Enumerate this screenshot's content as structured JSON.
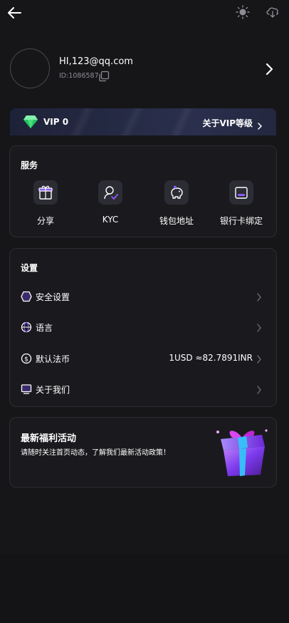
{
  "profile": {
    "email": "HI,123@qq.com",
    "uid": "ID:1086587"
  },
  "vip": {
    "level": "VIP 0",
    "link_label": "关于VIP等级"
  },
  "services": {
    "title": "服务",
    "items": [
      {
        "label": "分享",
        "icon": "gift-icon"
      },
      {
        "label": "KYC",
        "icon": "user-verify-icon"
      },
      {
        "label": "钱包地址",
        "icon": "piggy-bank-icon"
      },
      {
        "label": "银行卡绑定",
        "icon": "wallet-card-icon"
      }
    ]
  },
  "settings": {
    "title": "设置",
    "items": [
      {
        "label": "安全设置",
        "value": "",
        "icon": "shield-hexagon-icon"
      },
      {
        "label": "语言",
        "value": "",
        "icon": "globe-icon"
      },
      {
        "label": "默认法币",
        "value": "1USD ≈82.7891INR",
        "icon": "dollar-coin-icon"
      },
      {
        "label": "关于我们",
        "value": "",
        "icon": "monitor-icon"
      }
    ]
  },
  "promo": {
    "title": "最新福利活动",
    "subtitle": "请随时关注首页动态，了解我们最新活动政策！"
  },
  "colors": {
    "background": "#161619",
    "card": "#1a1a1e",
    "accent_purple": "#8b5cf6",
    "vip_banner": "#252a44"
  }
}
